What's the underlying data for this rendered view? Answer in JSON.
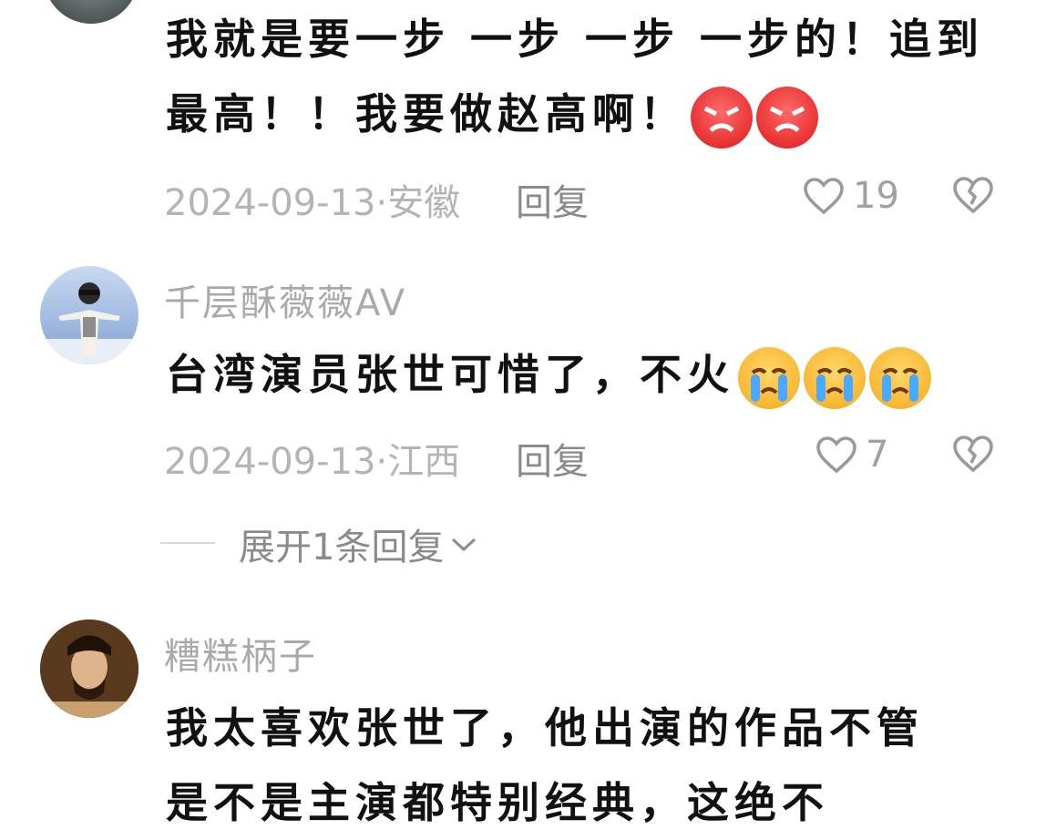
{
  "comments": [
    {
      "text": "我就是要一步 一步 一步 一步的！追到最高！！我要做赵高啊！",
      "date": "2024-09-13",
      "location": "安徽",
      "reply_label": "回复",
      "likes": "19",
      "emoji": [
        "angry-face-emoji",
        "angry-face-emoji"
      ]
    },
    {
      "username": "千层酥薇薇AV",
      "text": "台湾演员张世可惜了，不火",
      "date": "2024-09-13",
      "location": "江西",
      "reply_label": "回复",
      "likes": "7",
      "emoji": [
        "crying-face-emoji",
        "crying-face-emoji",
        "crying-face-emoji"
      ],
      "expand_label": "展开1条回复"
    },
    {
      "username": "糟糕柄子",
      "text": "我太喜欢张世了，他出演的作品不管是不是主演都特别经典，这绝不"
    }
  ],
  "meta_separator": "·",
  "colors": {
    "username": "#a9a9a9",
    "meta": "#b4b4b4",
    "icon": "#9a9a9a"
  }
}
